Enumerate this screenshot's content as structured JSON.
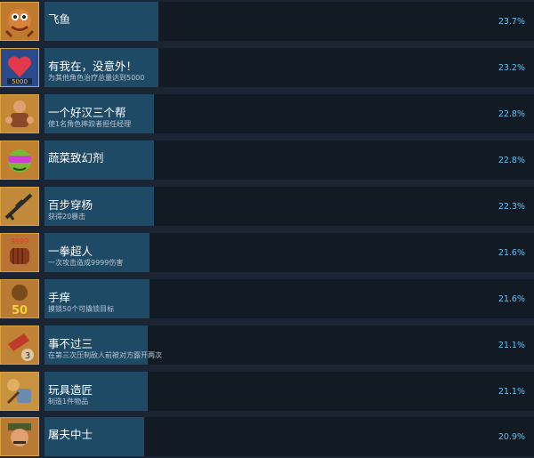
{
  "colors": {
    "page_bg": "#1a2433",
    "bar_bg": "#121a24",
    "bar_fill": "#1e4a66",
    "percent_text": "#66c0f4",
    "icon_frame": "#d9a23c"
  },
  "achievements": [
    {
      "title": "飞鱼",
      "description": "",
      "percent": "23.7%",
      "percent_value": 23.7,
      "icon": "flying-fish-icon"
    },
    {
      "title": "有我在，没意外！",
      "description": "为其他角色治疗总量达到5000",
      "percent": "23.2%",
      "percent_value": 23.2,
      "icon": "heart-5000-icon"
    },
    {
      "title": "一个好汉三个帮",
      "description": "使1名角色摔跤者担任经理",
      "percent": "22.8%",
      "percent_value": 22.8,
      "icon": "wrestler-manager-icon"
    },
    {
      "title": "蔬菜致幻剂",
      "description": "",
      "percent": "22.8%",
      "percent_value": 22.8,
      "icon": "goggles-vegetable-icon"
    },
    {
      "title": "百步穿杨",
      "description": "获得20暴击",
      "percent": "22.3%",
      "percent_value": 22.3,
      "icon": "sniper-rifle-icon"
    },
    {
      "title": "一拳超人",
      "description": "一次攻击造成9999伤害",
      "percent": "21.6%",
      "percent_value": 21.6,
      "icon": "fist-9999-icon"
    },
    {
      "title": "手痒",
      "description": "摸锁50个可撬锁目标",
      "percent": "21.6%",
      "percent_value": 21.6,
      "icon": "lockpick-50-icon"
    },
    {
      "title": "事不过三",
      "description": "在第三次压制敌人前被对方露开两次",
      "percent": "21.1%",
      "percent_value": 21.1,
      "icon": "three-strikes-icon"
    },
    {
      "title": "玩具造匠",
      "description": "制造1件物品",
      "percent": "21.1%",
      "percent_value": 21.1,
      "icon": "toy-maker-icon"
    },
    {
      "title": "屠夫中士",
      "description": "",
      "percent": "20.9%",
      "percent_value": 20.9,
      "icon": "sergeant-icon"
    }
  ]
}
